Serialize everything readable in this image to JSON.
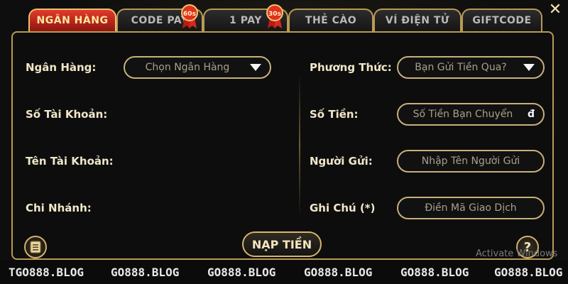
{
  "tabs": [
    {
      "label": "NGÂN HÀNG",
      "active": true
    },
    {
      "label": "CODE PAY",
      "badge": "60s"
    },
    {
      "label": "1 PAY",
      "badge": "30s"
    },
    {
      "label": "THẺ CÀO"
    },
    {
      "label": "VÍ ĐIỆN TỬ"
    },
    {
      "label": "GIFTCODE"
    }
  ],
  "form": {
    "left": {
      "bank_label": "Ngân Hàng:",
      "bank_select": "Chọn Ngân Hàng",
      "account_no_label": "Số Tài Khoản:",
      "account_name_label": "Tên Tài Khoản:",
      "branch_label": "Chi Nhánh:"
    },
    "right": {
      "method_label": "Phương Thức:",
      "method_select": "Bạn Gửi Tiền Qua?",
      "amount_label": "Số Tiền:",
      "amount_placeholder": "Số Tiền Bạn Chuyển",
      "currency": "đ",
      "sender_label": "Người Gửi:",
      "sender_placeholder": "Nhập Tên Người Gửi",
      "note_label": "Ghi Chú (*)",
      "note_placeholder": "Điền Mã Giao Dịch"
    }
  },
  "actions": {
    "submit": "NẠP TIỀN",
    "help": "?"
  },
  "watermark": "Activate Windows",
  "footer": [
    "TGO888.BLOG",
    "GO888.BLOG",
    "GO888.BLOG",
    "GO888.BLOG",
    "GO888.BLOG",
    "GO888.BLOG"
  ],
  "colors": {
    "gold": "#b99a55",
    "active_tab": "#e43a2a",
    "ribbon": "#d9281f"
  }
}
